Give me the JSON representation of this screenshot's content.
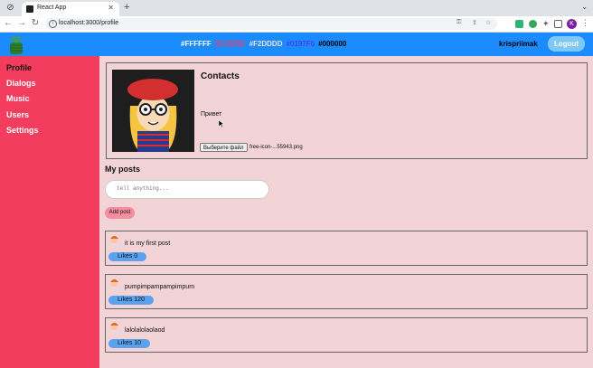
{
  "browser": {
    "tab_title": "React App",
    "url": "localhost:3000/profile",
    "profile_initial": "K"
  },
  "header": {
    "color_options": [
      {
        "label": "#FFFFFF",
        "color": "#FFFFFF"
      },
      {
        "label": "#F23D5E",
        "color": "#F23D5E"
      },
      {
        "label": "#F2DDDD",
        "color": "#F2DDDD"
      },
      {
        "label": "#0197F6",
        "color": "#0197F6"
      },
      {
        "label": "#000000",
        "color": "#000000"
      }
    ],
    "username": "krispriimak",
    "logout_label": "Logout"
  },
  "sidebar": {
    "items": [
      {
        "label": "Profile",
        "active": true
      },
      {
        "label": "Dialogs"
      },
      {
        "label": "Music"
      },
      {
        "label": "Users"
      },
      {
        "label": "Settings"
      }
    ]
  },
  "profile": {
    "title": "Contacts",
    "status": "Привет",
    "file_button_label": "Выберите файл",
    "file_name": "free-icon-...55943.png"
  },
  "posts": {
    "title": "My posts",
    "input_placeholder": "tell anything...",
    "add_button_label": "Add post",
    "items": [
      {
        "text": "it is my first post",
        "likes_label": "Likes 0"
      },
      {
        "text": "pumpimpampampimpum",
        "likes_label": "Likes 120"
      },
      {
        "text": "lalolalolaolaod",
        "likes_label": "Likes 10"
      }
    ]
  },
  "colors": {
    "sidebar": "#F23D5E",
    "header": "#1A8CFF",
    "content_bg": "#F2D4D7"
  }
}
